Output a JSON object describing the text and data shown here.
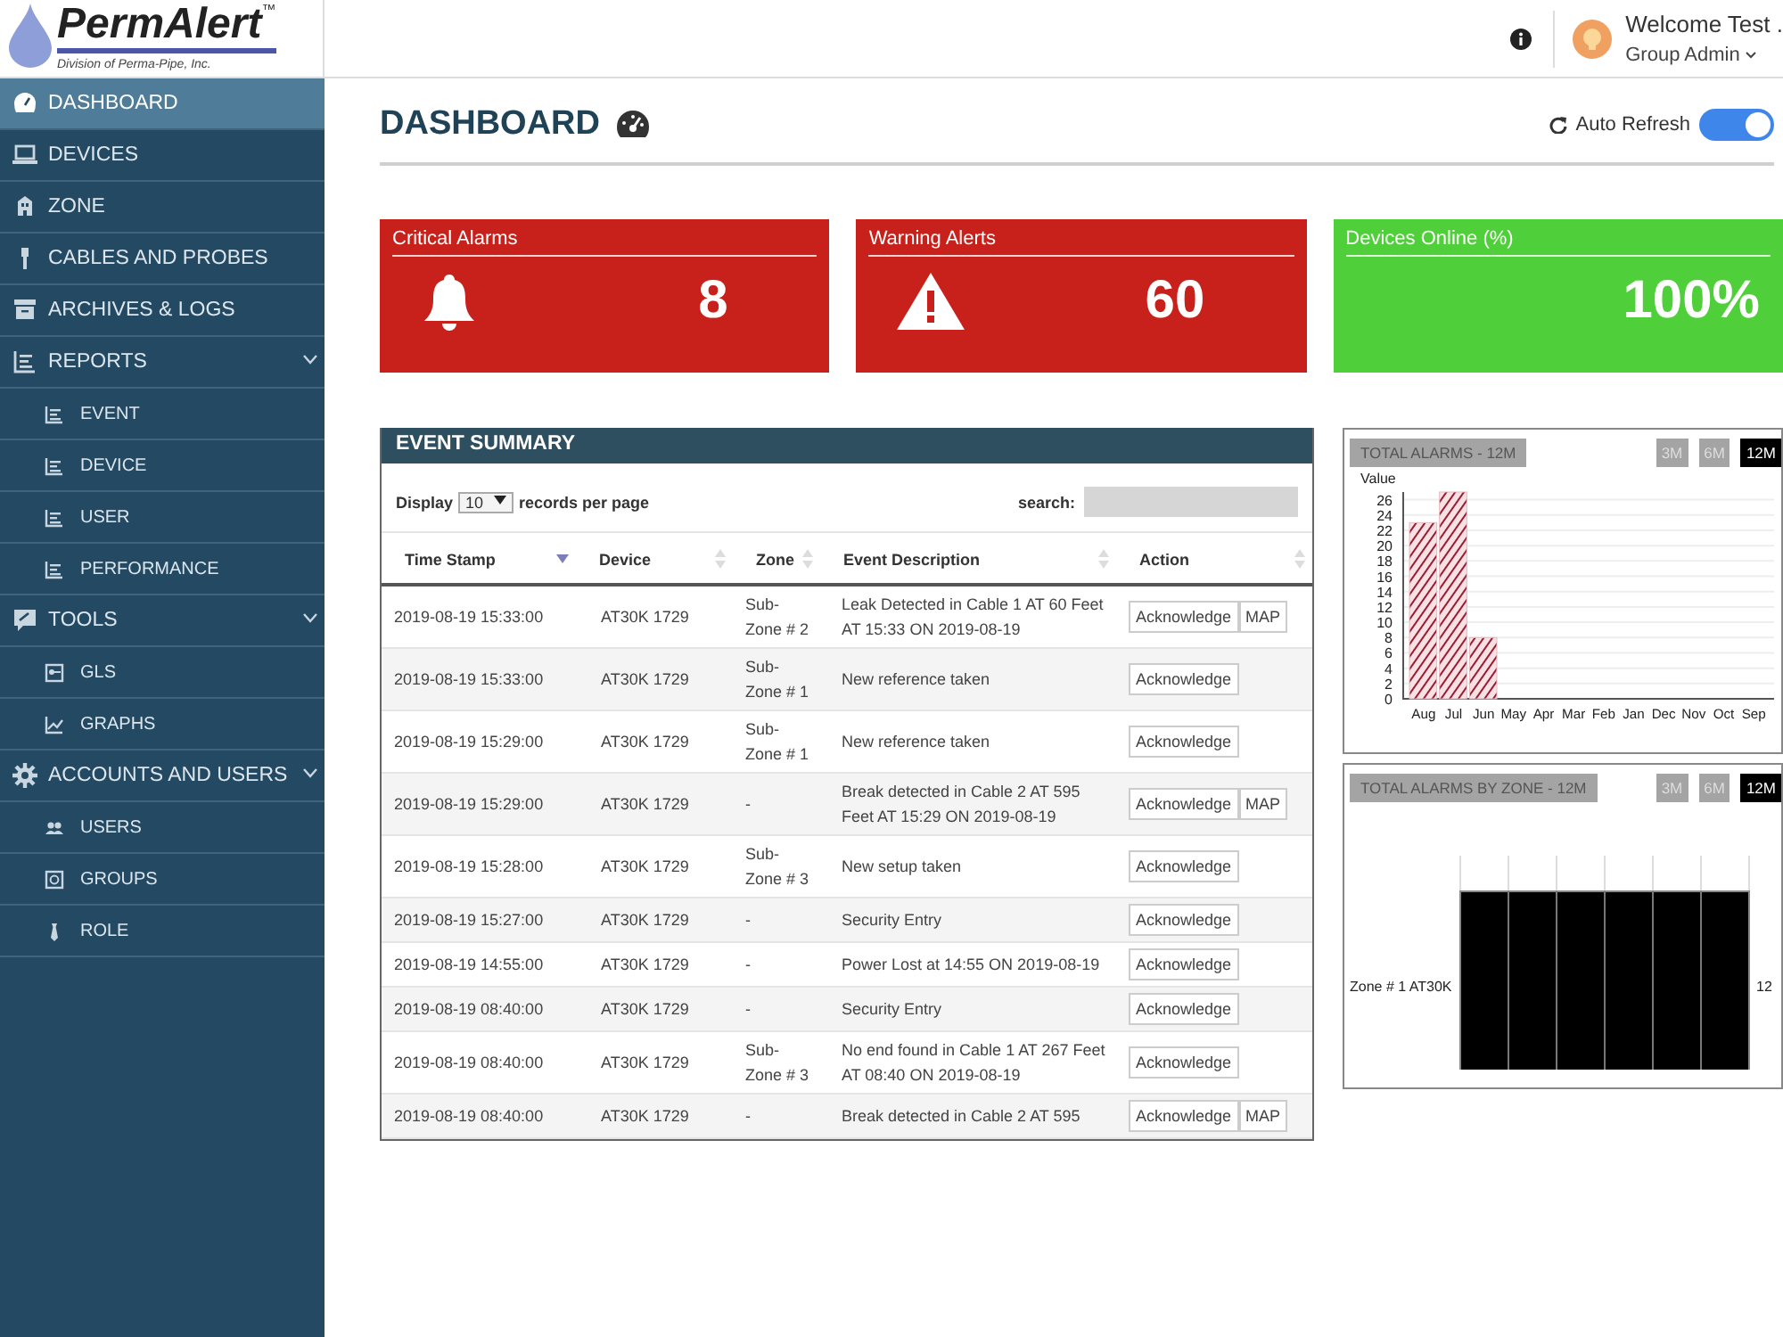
{
  "header": {
    "logo_text": "PermAlert",
    "logo_mark": "™",
    "logo_subtitle": "Division of Perma-Pipe, Inc.",
    "welcome": "Welcome Test .",
    "role": "Group Admin"
  },
  "sidebar": {
    "items": [
      {
        "label": "DASHBOARD",
        "selected": true
      },
      {
        "label": "DEVICES",
        "selected": false
      },
      {
        "label": "ZONE",
        "selected": false
      },
      {
        "label": "CABLES AND PROBES",
        "selected": false
      },
      {
        "label": "ARCHIVES & LOGS",
        "selected": false
      },
      {
        "label": "REPORTS",
        "selected": false,
        "expanded": true,
        "children": [
          {
            "label": "EVENT",
            "selected": false
          },
          {
            "label": "DEVICE",
            "selected": false
          },
          {
            "label": "USER",
            "selected": false
          },
          {
            "label": "PERFORMANCE",
            "selected": false
          }
        ]
      },
      {
        "label": "TOOLS",
        "selected": false,
        "expanded": true,
        "children": [
          {
            "label": "GLS",
            "selected": false
          },
          {
            "label": "GRAPHS",
            "selected": false
          }
        ]
      },
      {
        "label": "ACCOUNTS AND USERS",
        "selected": false,
        "expanded": true,
        "children": [
          {
            "label": "USERS",
            "selected": false
          },
          {
            "label": "GROUPS",
            "selected": false
          },
          {
            "label": "ROLE",
            "selected": false
          }
        ]
      }
    ]
  },
  "page": {
    "title": "DASHBOARD",
    "auto_refresh": {
      "label": "Auto Refresh",
      "on": true
    }
  },
  "stats": [
    {
      "label": "Critical Alarms",
      "value": "8",
      "kind": "critical",
      "color": "#c8201b"
    },
    {
      "label": "Warning Alerts",
      "value": "60",
      "kind": "warning",
      "color": "#c8201b"
    },
    {
      "label": "Devices Online (%)",
      "value": "100%",
      "kind": "online",
      "color": "#4fcf39"
    }
  ],
  "event_summary": {
    "title": "EVENT SUMMARY",
    "display_label": "Display",
    "page_size": "10",
    "records_label": "records per page",
    "search_label": "search:",
    "columns": [
      {
        "label": "Time Stamp",
        "sorted": true
      },
      {
        "label": "Device",
        "sorted": false
      },
      {
        "label": "Zone",
        "sorted": false
      },
      {
        "label": "Event Description",
        "sorted": false
      },
      {
        "label": "Action",
        "sorted": false
      }
    ],
    "rows": [
      {
        "time": "2019-08-19 15:33:00",
        "device": "AT30K 1729",
        "zone": "Sub-Zone # 2",
        "description": "Leak Detected in Cable 1 AT 60 Feet AT 15:33 ON 2019-08-19",
        "actions": [
          "Acknowledge",
          "MAP"
        ]
      },
      {
        "time": "2019-08-19 15:33:00",
        "device": "AT30K 1729",
        "zone": "Sub-Zone # 1",
        "description": "New reference taken",
        "actions": [
          "Acknowledge"
        ]
      },
      {
        "time": "2019-08-19 15:29:00",
        "device": "AT30K 1729",
        "zone": "Sub-Zone # 1",
        "description": "New reference taken",
        "actions": [
          "Acknowledge"
        ]
      },
      {
        "time": "2019-08-19 15:29:00",
        "device": "AT30K 1729",
        "zone": "-",
        "description": "Break detected in Cable 2 AT 595 Feet AT 15:29 ON 2019-08-19",
        "actions": [
          "Acknowledge",
          "MAP"
        ]
      },
      {
        "time": "2019-08-19 15:28:00",
        "device": "AT30K 1729",
        "zone": "Sub-Zone # 3",
        "description": "New setup taken",
        "actions": [
          "Acknowledge"
        ]
      },
      {
        "time": "2019-08-19 15:27:00",
        "device": "AT30K 1729",
        "zone": "-",
        "description": "Security Entry",
        "actions": [
          "Acknowledge"
        ]
      },
      {
        "time": "2019-08-19 14:55:00",
        "device": "AT30K 1729",
        "zone": "-",
        "description": "Power Lost at 14:55 ON 2019-08-19",
        "actions": [
          "Acknowledge"
        ]
      },
      {
        "time": "2019-08-19 08:40:00",
        "device": "AT30K 1729",
        "zone": "-",
        "description": "Security Entry",
        "actions": [
          "Acknowledge"
        ]
      },
      {
        "time": "2019-08-19 08:40:00",
        "device": "AT30K 1729",
        "zone": "Sub-Zone # 3",
        "description": "No end found in Cable 1 AT 267 Feet AT 08:40 ON 2019-08-19",
        "actions": [
          "Acknowledge"
        ]
      },
      {
        "time": "2019-08-19 08:40:00",
        "device": "AT30K 1729",
        "zone": "-",
        "description": "Break detected in Cable 2 AT 595",
        "actions": [
          "Acknowledge",
          "MAP"
        ]
      }
    ]
  },
  "charts": [
    {
      "title": "TOTAL ALARMS - 12M",
      "ranges": [
        {
          "label": "3M",
          "selected": false
        },
        {
          "label": "6M",
          "selected": false
        },
        {
          "label": "12M",
          "selected": true
        }
      ],
      "chart_data": {
        "type": "bar",
        "ylabel": "Value",
        "categories": [
          "Aug",
          "Jul",
          "Jun",
          "May",
          "Apr",
          "Mar",
          "Feb",
          "Jan",
          "Dec",
          "Nov",
          "Oct",
          "Sep"
        ],
        "values": [
          23,
          27,
          8,
          0,
          0,
          0,
          0,
          0,
          0,
          0,
          0,
          0
        ],
        "yticks": [
          0,
          2,
          4,
          6,
          8,
          10,
          12,
          14,
          16,
          18,
          20,
          22,
          24,
          26
        ],
        "ylim": [
          0,
          27
        ],
        "grid": true
      }
    },
    {
      "title": "TOTAL ALARMS BY ZONE - 12M",
      "ranges": [
        {
          "label": "3M",
          "selected": false
        },
        {
          "label": "6M",
          "selected": false
        },
        {
          "label": "12M",
          "selected": true
        }
      ],
      "zone_label": "Zone # 1 AT30K",
      "value_label": "12"
    }
  ]
}
